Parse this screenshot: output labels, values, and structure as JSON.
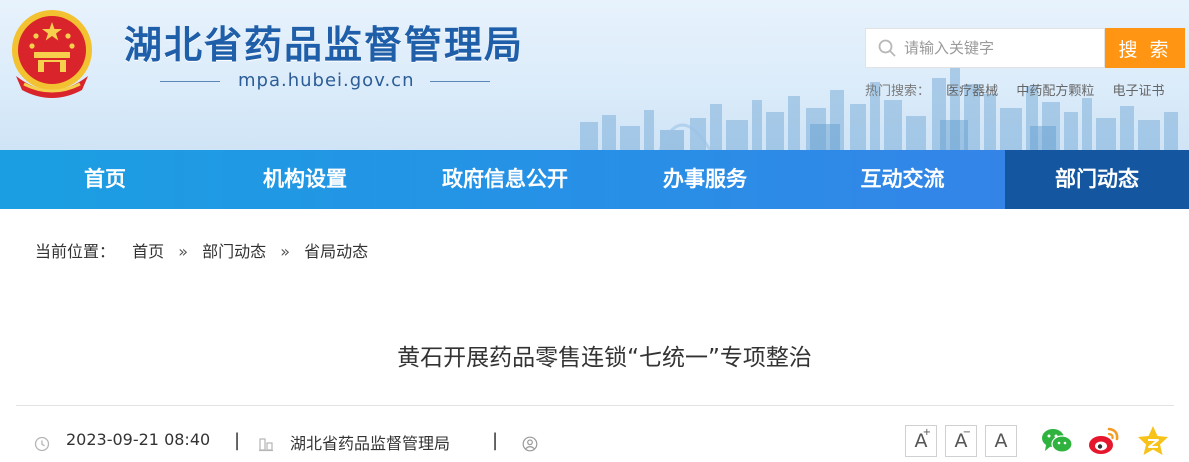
{
  "header": {
    "site_title": "湖北省药品监督管理局",
    "domain": "mpa.hubei.gov.cn",
    "emblem_icon": "national-emblem-icon"
  },
  "search": {
    "placeholder": "请输入关键字",
    "value": "",
    "button_label": "搜 索",
    "button_color": "#ff9512"
  },
  "hot_search": {
    "label": "热门搜索：",
    "items": [
      "医疗器械",
      "中药配方颗粒",
      "电子证书"
    ]
  },
  "nav": {
    "items": [
      {
        "label": "首页"
      },
      {
        "label": "机构设置"
      },
      {
        "label": "政府信息公开"
      },
      {
        "label": "办事服务"
      },
      {
        "label": "互动交流"
      },
      {
        "label": "部门动态"
      }
    ],
    "active": "部门动态",
    "bar_color": "#1b9fe2",
    "active_color": "#1456a0"
  },
  "breadcrumb": {
    "label": "当前位置：",
    "items": [
      "首页",
      "部门动态",
      "省局动态"
    ],
    "separator": "»"
  },
  "article": {
    "title": "黄石开展药品零售连锁“七统一”专项整治",
    "datetime": "2023-09-21 08:40",
    "source": "湖北省药品监督管理局",
    "separator": "|"
  },
  "tools": {
    "font_size": [
      "A",
      "A",
      "A"
    ],
    "share_icons": [
      "wechat-icon",
      "weibo-icon",
      "qzone-icon"
    ]
  }
}
